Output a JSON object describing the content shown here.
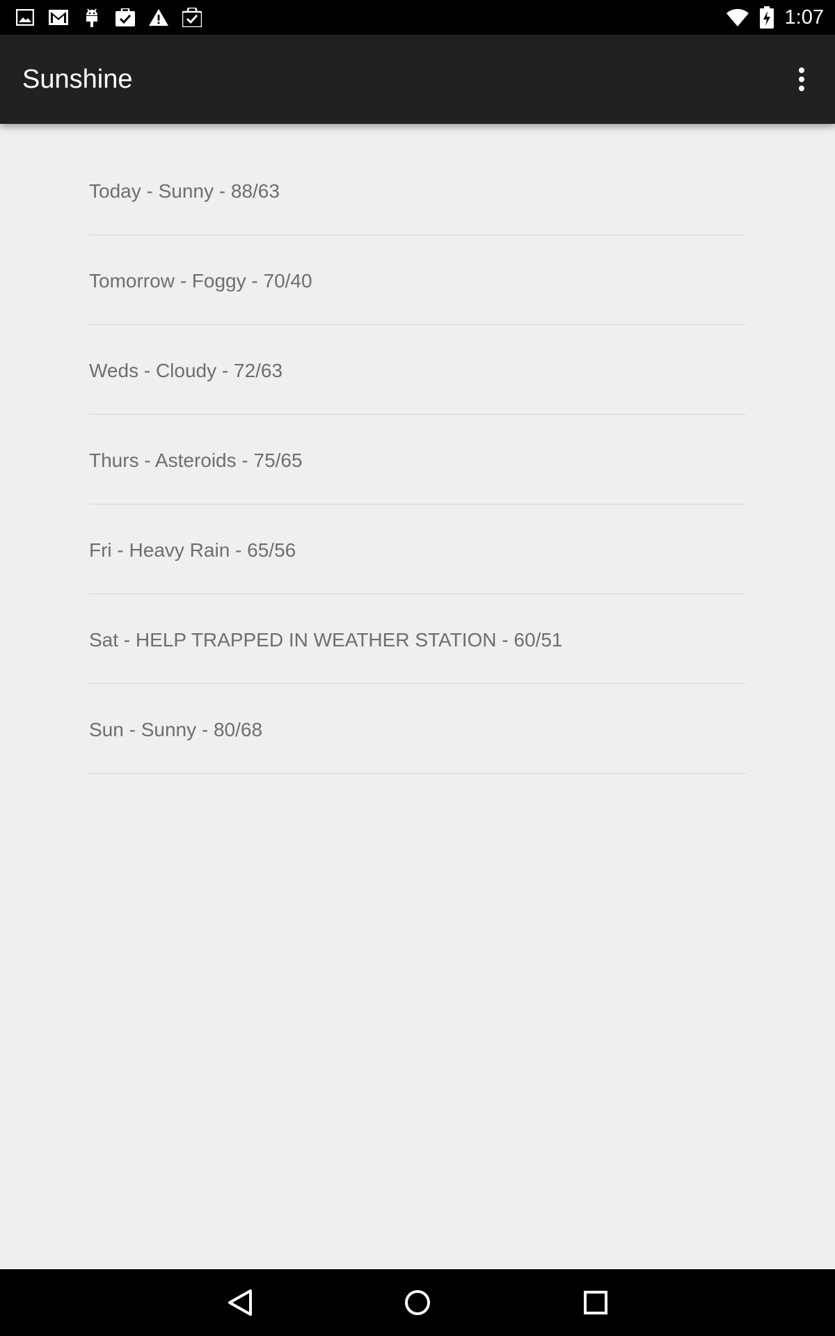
{
  "status_bar": {
    "time": "1:07",
    "left_icons": [
      "image-icon",
      "gmail-icon",
      "android-icon",
      "clipboard-check-icon",
      "warning-icon",
      "shopping-check-icon"
    ],
    "right_icons": [
      "wifi-icon",
      "battery-charging-icon"
    ]
  },
  "app_bar": {
    "title": "Sunshine",
    "overflow_icon": "more-vert-icon"
  },
  "forecast": {
    "items": [
      {
        "label": "Today - Sunny - 88/63"
      },
      {
        "label": "Tomorrow - Foggy - 70/40"
      },
      {
        "label": "Weds - Cloudy - 72/63"
      },
      {
        "label": "Thurs - Asteroids - 75/65"
      },
      {
        "label": "Fri - Heavy Rain - 65/56"
      },
      {
        "label": "Sat - HELP TRAPPED IN WEATHER STATION - 60/51"
      },
      {
        "label": "Sun - Sunny - 80/68"
      }
    ]
  },
  "nav_bar": {
    "buttons": [
      "back-icon",
      "home-icon",
      "recents-icon"
    ]
  },
  "colors": {
    "app_bar": "#212121",
    "background": "#efefef",
    "list_text": "#6e6e6e",
    "divider": "#d6d6d6"
  }
}
